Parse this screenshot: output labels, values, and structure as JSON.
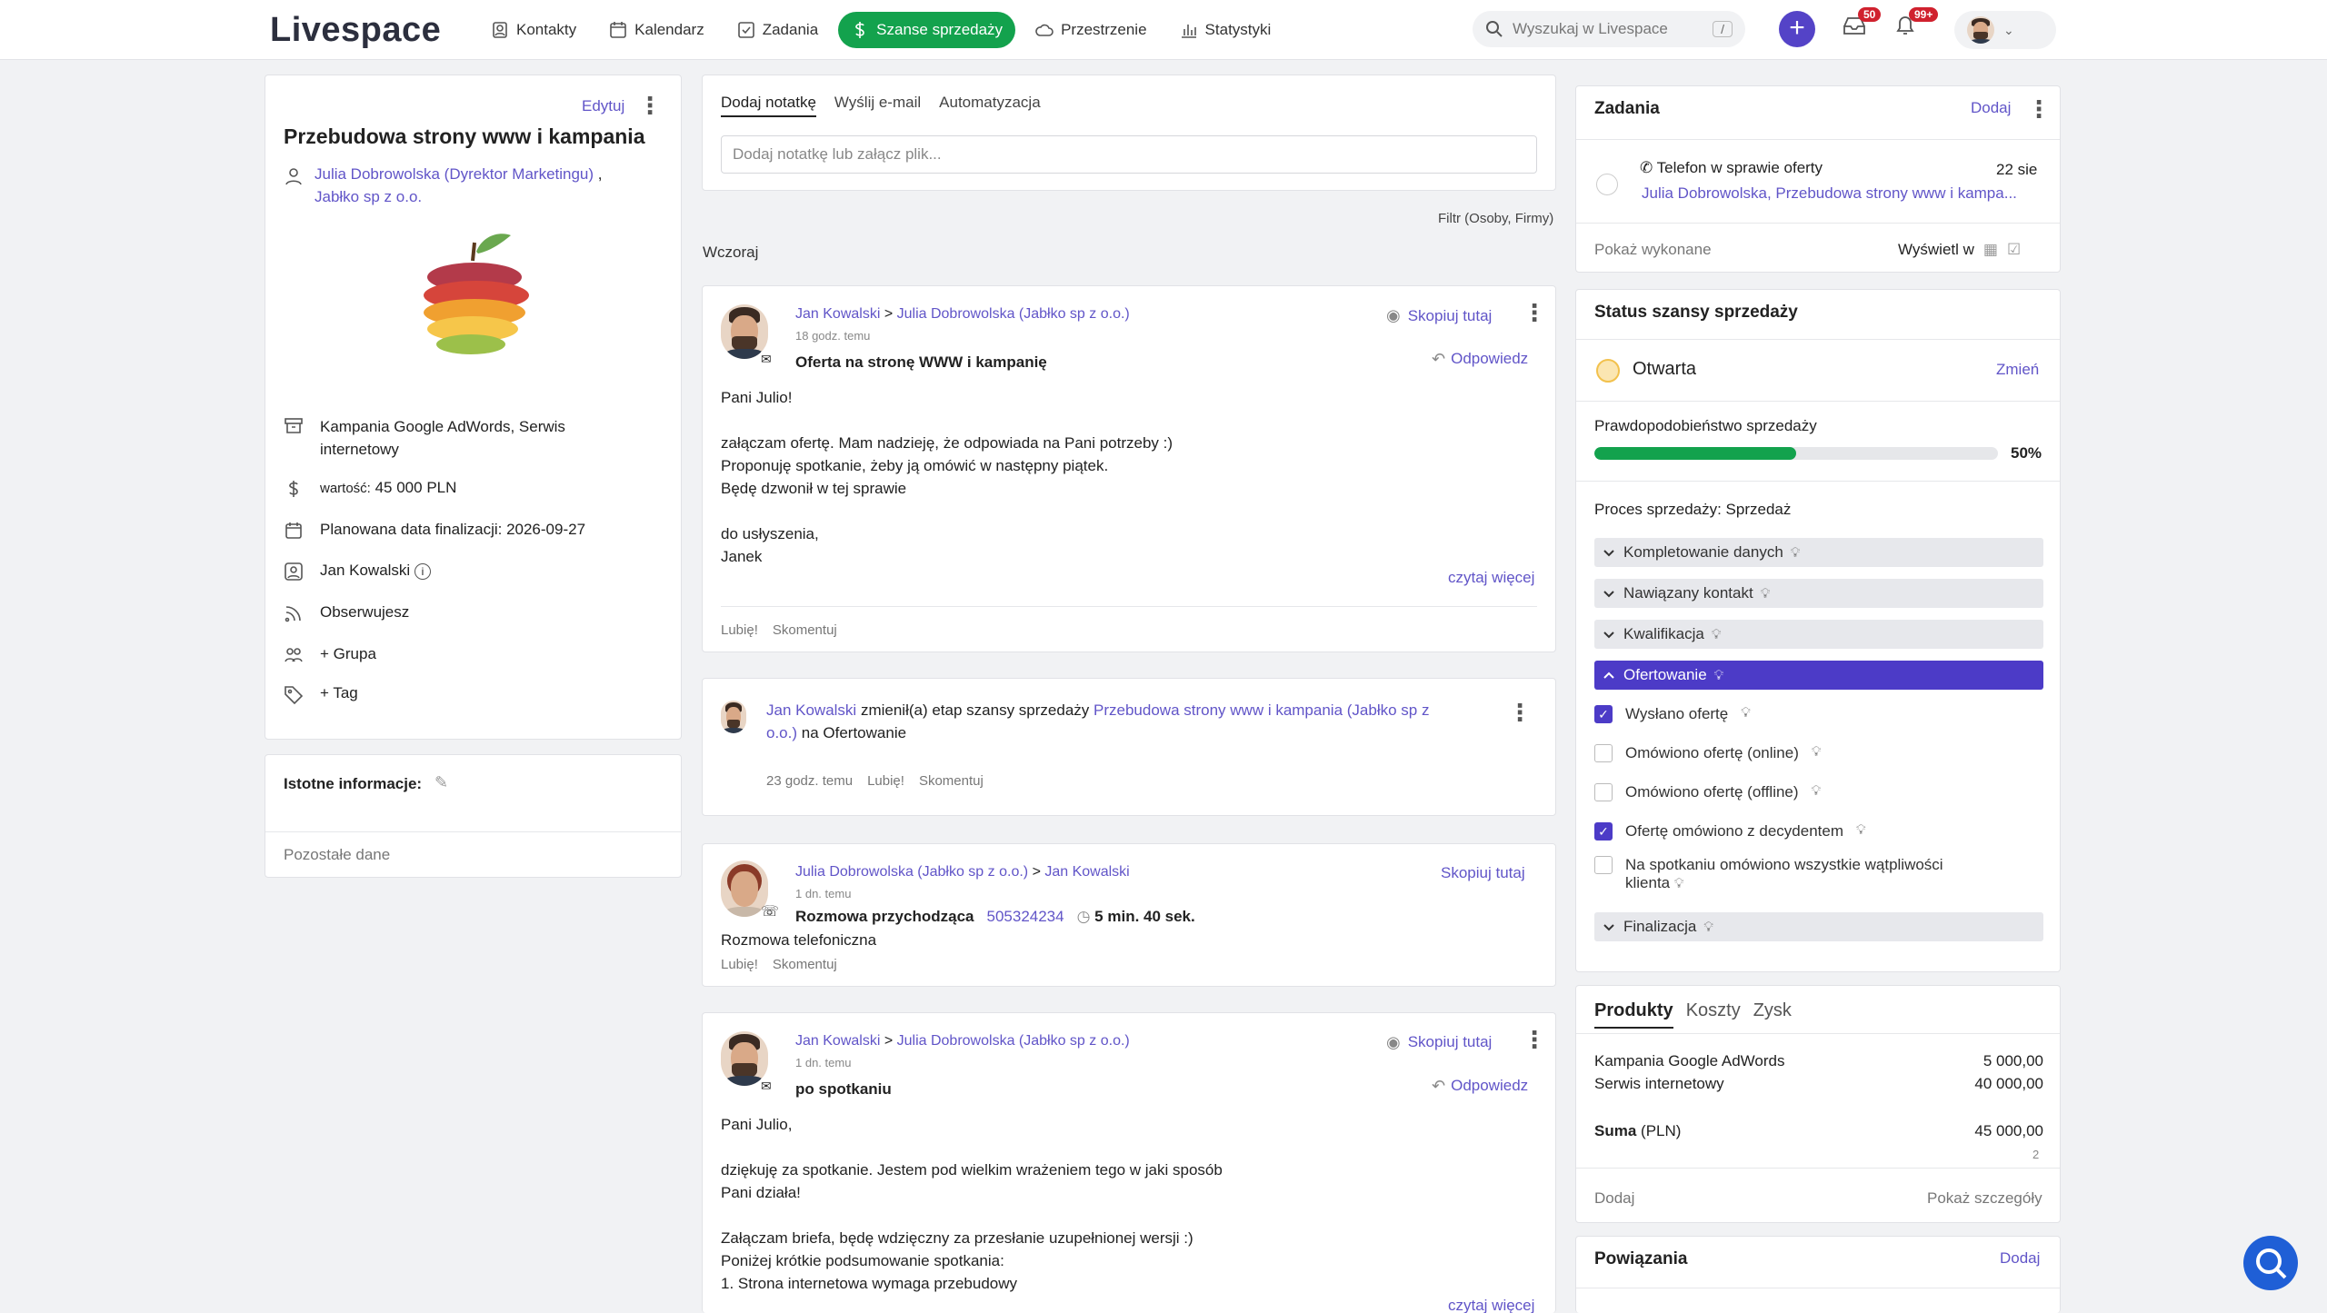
{
  "nav": {
    "logo": "Livespace",
    "items": [
      {
        "label": "Kontakty",
        "icon": "contact-icon"
      },
      {
        "label": "Kalendarz",
        "icon": "calendar-icon"
      },
      {
        "label": "Zadania",
        "icon": "task-icon"
      },
      {
        "label": "Szanse sprzedaży",
        "icon": "dollar-icon"
      },
      {
        "label": "Przestrzenie",
        "icon": "cloud-icon"
      },
      {
        "label": "Statystyki",
        "icon": "stats-icon"
      }
    ],
    "search_placeholder": "Wyszukaj w Livespace",
    "search_shortcut": "/",
    "inbox_badge": "50",
    "notif_badge": "99+"
  },
  "deal": {
    "edit": "Edytuj",
    "title": "Przebudowa strony www i kampania",
    "contact": "Julia Dobrowolska (Dyrektor Marketingu)",
    "sep": ",",
    "company": "Jabłko sp z o.o.",
    "products": "Kampania Google AdWords, Serwis internetowy",
    "value_label": "wartość:",
    "value": "45 000 PLN",
    "close_date": "Planowana data finalizacji: 2026-09-27",
    "owner": "Jan Kowalski",
    "follow": "Obserwujesz",
    "group": "+ Grupa",
    "tag": "+ Tag",
    "important": "Istotne informacje:",
    "other": "Pozostałe dane"
  },
  "composer": {
    "tabs": [
      "Dodaj notatkę",
      "Wyślij e-mail",
      "Automatyzacja"
    ],
    "placeholder": "Dodaj notatkę lub załącz plik...",
    "filter": "Filtr (Osoby, Firmy)",
    "day": "Wczoraj"
  },
  "feed": {
    "e1": {
      "from": "Jan Kowalski",
      "arrow": ">",
      "to": "Julia Dobrowolska (Jabłko sp z o.o.)",
      "time": "18 godz. temu",
      "subject": "Oferta na stronę WWW i kampanię",
      "copy": "Skopiuj tutaj",
      "reply": "Odpowiedz",
      "lines": [
        "Pani Julio!",
        "",
        "załączam ofertę. Mam nadzieję, że odpowiada na Pani potrzeby :)",
        "Proponuję spotkanie, żeby ją omówić w następny piątek.",
        "Będę dzwonił w tej sprawie",
        "",
        "do usłyszenia,",
        "Janek"
      ],
      "more": "czytaj więcej",
      "like": "Lubię!",
      "comment": "Skomentuj"
    },
    "e2": {
      "who": "Jan Kowalski",
      "text1": "zmienił(a) etap szansy sprzedaży",
      "deal": "Przebudowa strony www i kampania (Jabłko sp z o.o.)",
      "text2": "na Ofertowanie",
      "time": "23 godz. temu",
      "like": "Lubię!",
      "comment": "Skomentuj"
    },
    "e3": {
      "from": "Julia Dobrowolska (Jabłko sp z o.o.)",
      "arrow": ">",
      "to": "Jan Kowalski",
      "time": "1 dn. temu",
      "copy": "Skopiuj tutaj",
      "subject": "Rozmowa przychodząca",
      "phone": "505324234",
      "duration": "5 min. 40 sek.",
      "body": "Rozmowa telefoniczna",
      "like": "Lubię!",
      "comment": "Skomentuj"
    },
    "e4": {
      "from": "Jan Kowalski",
      "arrow": ">",
      "to": "Julia Dobrowolska (Jabłko sp z o.o.)",
      "time": "1 dn. temu",
      "subject": "po spotkaniu",
      "copy": "Skopiuj tutaj",
      "reply": "Odpowiedz",
      "lines": [
        "Pani Julio,",
        "",
        "dziękuję za spotkanie. Jestem pod wielkim wrażeniem tego w jaki sposób",
        "Pani działa!",
        "",
        "Załączam briefa, będę wdzięczny za przesłanie uzupełnionej wersji :)",
        "Poniżej krótkie podsumowanie spotkania:",
        "1. Strona internetowa wymaga przebudowy"
      ],
      "more": "czytaj więcej"
    }
  },
  "tasks": {
    "title": "Zadania",
    "add": "Dodaj",
    "task_title": "Telefon w sprawie oferty",
    "task_date": "22 sie",
    "task_links": "Julia Dobrowolska, Przebudowa strony www i kampa...",
    "show_done": "Pokaż wykonane",
    "view_in": "Wyświetl w"
  },
  "status": {
    "title": "Status szansy sprzedaży",
    "state": "Otwarta",
    "change": "Zmień",
    "prob_label": "Prawdopodobieństwo sprzedaży",
    "prob": "50%",
    "prob_value": 0.5,
    "process": "Proces sprzedaży: Sprzedaż",
    "stages": [
      "Kompletowanie danych",
      "Nawiązany kontakt",
      "Kwalifikacja",
      "Ofertowanie",
      "Finalizacja"
    ],
    "checks": [
      {
        "label": "Wysłano ofertę",
        "checked": true
      },
      {
        "label": "Omówiono ofertę (online)",
        "checked": false
      },
      {
        "label": "Omówiono ofertę (offline)",
        "checked": false
      },
      {
        "label": "Ofertę omówiono z decydentem",
        "checked": true
      },
      {
        "label": "Na spotkaniu omówiono wszystkie wątpliwości klienta",
        "checked": false
      }
    ]
  },
  "products": {
    "tabs": [
      "Produkty",
      "Koszty",
      "Zysk"
    ],
    "items": [
      {
        "name": "Kampania Google AdWords",
        "value": "5 000,00"
      },
      {
        "name": "Serwis internetowy",
        "value": "40 000,00"
      }
    ],
    "sum_label": "Suma",
    "sum_currency": "(PLN)",
    "sum_value": "45 000,00",
    "count": "2",
    "add": "Dodaj",
    "details": "Pokaż szczegóły"
  },
  "relations": {
    "title": "Powiązania",
    "add": "Dodaj"
  },
  "colors": {
    "brand": "#5443c7",
    "green": "#13a24d",
    "link": "#6155c8"
  }
}
